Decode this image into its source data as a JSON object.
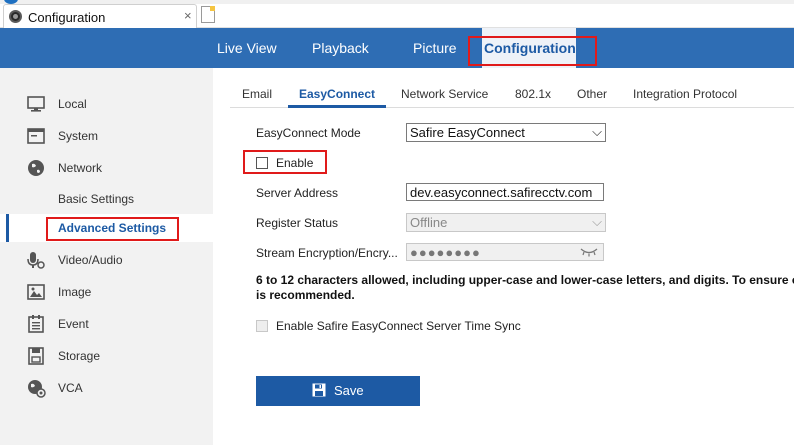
{
  "browser": {
    "tab_title": "Configuration",
    "tab_close": "×"
  },
  "topnav": {
    "items": [
      {
        "label": "Live View"
      },
      {
        "label": "Playback"
      },
      {
        "label": "Picture"
      },
      {
        "label": "Configuration",
        "active": true
      }
    ]
  },
  "sidebar": {
    "items": [
      {
        "label": "Local",
        "icon": "monitor-icon"
      },
      {
        "label": "System",
        "icon": "system-icon"
      },
      {
        "label": "Network",
        "icon": "globe-icon"
      },
      {
        "label": "Basic Settings",
        "sub": true
      },
      {
        "label": "Advanced Settings",
        "sub": true,
        "active": true
      },
      {
        "label": "Video/Audio",
        "icon": "mic-icon"
      },
      {
        "label": "Image",
        "icon": "image-icon"
      },
      {
        "label": "Event",
        "icon": "event-icon"
      },
      {
        "label": "Storage",
        "icon": "storage-icon"
      },
      {
        "label": "VCA",
        "icon": "vca-icon"
      }
    ]
  },
  "subtabs": {
    "items": [
      {
        "label": "Email"
      },
      {
        "label": "EasyConnect",
        "active": true
      },
      {
        "label": "Network Service"
      },
      {
        "label": "802.1x"
      },
      {
        "label": "Other"
      },
      {
        "label": "Integration Protocol"
      }
    ]
  },
  "form": {
    "mode_label": "EasyConnect Mode",
    "mode_value": "Safire EasyConnect",
    "enable_label": "Enable",
    "enable_checked": false,
    "server_label": "Server Address",
    "server_value": "dev.easyconnect.safirecctv.com",
    "status_label": "Register Status",
    "status_value": "Offline",
    "encryption_label": "Stream Encryption/Encry...",
    "encryption_value": "●●●●●●●●",
    "note_line1": "6 to 12 characters allowed, including upper-case and lower-case letters, and digits. To ensure c",
    "note_line2": "is recommended.",
    "time_sync_label": "Enable Safire EasyConnect Server Time Sync",
    "save_label": "Save"
  },
  "colors": {
    "nav_blue": "#2e6db4",
    "accent": "#1d5aa4",
    "highlight_red": "#e01a1a"
  }
}
